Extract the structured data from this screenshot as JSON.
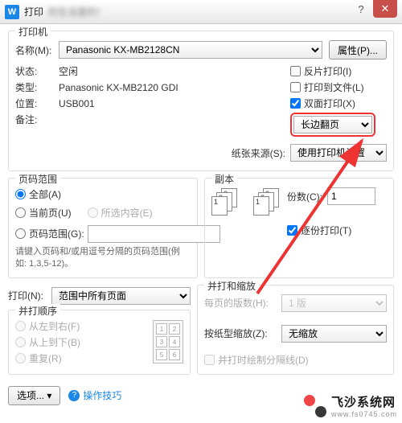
{
  "titlebar": {
    "app_glyph": "W",
    "title": "打印"
  },
  "printer": {
    "legend": "打印机",
    "name_label": "名称(M):",
    "name_value": "Panasonic KX-MB2128CN",
    "properties_btn": "属性(P)...",
    "status_label": "状态:",
    "status_value": "空闲",
    "type_label": "类型:",
    "type_value": "Panasonic KX-MB2120 GDI",
    "where_label": "位置:",
    "where_value": "USB001",
    "comment_label": "备注:",
    "reverse_chk": "反片打印(I)",
    "tofile_chk": "打印到文件(L)",
    "duplex_chk": "双面打印(X)",
    "duplex_mode": "长边翻页",
    "source_label": "纸张来源(S):",
    "source_value": "使用打印机设置"
  },
  "range": {
    "legend": "页码范围",
    "all": "全部(A)",
    "current": "当前页(U)",
    "selection": "所选内容(E)",
    "pages_label": "页码范围(G):",
    "hint": "请键入页码和/或用逗号分隔的页码范围(例如: 1,3,5-12)。",
    "print_label": "打印(N):",
    "print_value": "范围中所有页面"
  },
  "copies": {
    "legend": "副本",
    "count_label": "份数(C):",
    "count_value": "1",
    "collate": "逐份打印(T)"
  },
  "scale": {
    "legend": "并打和缩放",
    "pps_label": "每页的版数(H):",
    "pps_value": "1 版",
    "zoom_label": "按纸型缩放(Z):",
    "zoom_value": "无缩放",
    "lines_chk": "并打时绘制分隔线(D)"
  },
  "order": {
    "legend": "并打顺序",
    "lr": "从左到右(F)",
    "tb": "从上到下(B)",
    "repeat": "重复(R)"
  },
  "footer": {
    "options": "选项...",
    "tips": "操作技巧"
  },
  "watermark": {
    "name": "飞沙系统网",
    "url": "www.fs0745.com"
  }
}
